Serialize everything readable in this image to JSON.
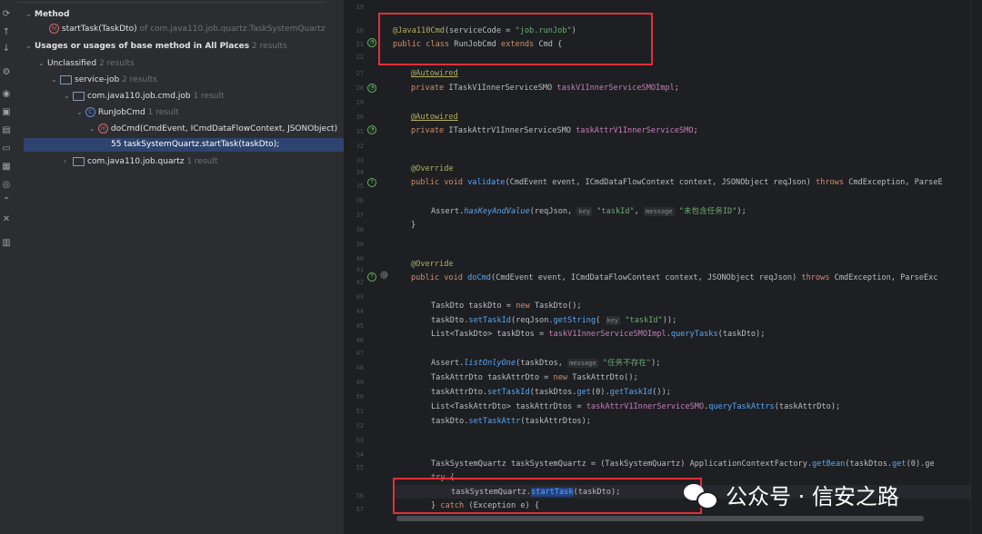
{
  "tree": {
    "method_header": "Method",
    "method_name": "startTask(TaskDto)",
    "method_of": "of com.java110.job.quartz.TaskSystemQuartz",
    "usages_header": "Usages or usages of base method in All Places",
    "usages_count": "2 results",
    "unclassified": "Unclassified",
    "unclassified_count": "2 results",
    "service_job": "service-job",
    "service_job_count": "2 results",
    "pkg_cmd": "com.java110.job.cmd.job",
    "pkg_cmd_count": "1 result",
    "class_name": "RunJobCmd",
    "class_count": "1 result",
    "docmd_sig": "doCmd(CmdEvent, ICmdDataFlowContext, JSONObject)",
    "usage_line": "55 taskSystemQuartz.startTask(taskDto);",
    "pkg_quartz": "com.java110.job.quartz",
    "pkg_quartz_count": "1 result"
  },
  "lines": [
    "19",
    "20",
    "21",
    "22",
    "27",
    "28",
    "29",
    "30",
    "31",
    "32",
    "33",
    "34",
    "35",
    "36",
    "37",
    "38",
    "39",
    "40",
    "41",
    "42",
    "43",
    "44",
    "45",
    "46",
    "47",
    "48",
    "49",
    "50",
    "51",
    "52",
    "53",
    "54",
    "55",
    "56",
    "57"
  ],
  "code": {
    "l1_ann": "@Java110Cmd",
    "l1_open": "(serviceCode = ",
    "l1_str": "\"job.runJob\"",
    "l1_close": ")",
    "l2_kw": "public class ",
    "l2_name": "RunJobCmd ",
    "l2_kw2": "extends ",
    "l2_rest": "Cmd {",
    "aw1": "@Autowired",
    "f1_kw": "private ",
    "f1_type": "ITaskV1InnerServiceSMO ",
    "f1_name": "taskV1InnerServiceSMOImpl",
    "f1_end": ";",
    "aw2": "@Autowired",
    "f2_kw": "private ",
    "f2_type": "ITaskAttrV1InnerServiceSMO ",
    "f2_name": "taskAttrV1InnerServiceSMO",
    "f2_end": ";",
    "ov1": "@Override",
    "v_kw": "public void ",
    "v_name": "validate",
    "v_rest": "(CmdEvent event, ICmdDataFlowContext context, JSONObject reqJson) ",
    "v_kw2": "throws ",
    "v_exc": "CmdException, ParseE",
    "assert1_a": "Assert.",
    "assert1_m": "hasKeyAndValue",
    "assert1_b": "(reqJson, ",
    "hint_key": "key",
    "assert1_s1": "\"taskId\"",
    "assert1_c": ", ",
    "hint_msg": "message",
    "assert1_s2": "\"未包含任务ID\"",
    "assert1_end": ");",
    "brace": "}",
    "ov2": "@Override",
    "d_kw": "public void ",
    "d_name": "doCmd",
    "d_rest": "(CmdEvent event, ICmdDataFlowContext context, JSONObject reqJson) ",
    "d_kw2": "throws ",
    "d_exc": "CmdException, ParseExc",
    "t1_a": "TaskDto taskDto = ",
    "t1_kw": "new ",
    "t1_b": "TaskDto();",
    "t2_a": "taskDto.",
    "t2_m": "setTaskId",
    "t2_b": "(reqJson.",
    "t2_m2": "getString",
    "t2_c": "( ",
    "t2_s": "\"taskId\"",
    "t2_d": "));",
    "t3_a": "List<TaskDto> taskDtos = ",
    "t3_f": "taskV1InnerServiceSMOImpl",
    "t3_b": ".",
    "t3_m": "queryTasks",
    "t3_c": "(taskDto);",
    "t4_a": "Assert.",
    "t4_m": "listOnlyOne",
    "t4_b": "(taskDtos, ",
    "t4_s": "\"任务不存在\"",
    "t4_c": ");",
    "t5_a": "TaskAttrDto taskAttrDto = ",
    "t5_kw": "new ",
    "t5_b": "TaskAttrDto();",
    "t6_a": "taskAttrDto.",
    "t6_m": "setTaskId",
    "t6_b": "(taskDtos.",
    "t6_m2": "get",
    "t6_c": "(0).",
    "t6_m3": "getTaskId",
    "t6_d": "());",
    "t7_a": "List<TaskAttrDto> taskAttrDtos = ",
    "t7_f": "taskAttrV1InnerServiceSMO",
    "t7_b": ".",
    "t7_m": "queryTaskAttrs",
    "t7_c": "(taskAttrDto);",
    "t8_a": "taskDto.",
    "t8_m": "setTaskAttr",
    "t8_b": "(taskAttrDtos);",
    "t9_a": "TaskSystemQuartz taskSystemQuartz = (TaskSystemQuartz) ApplicationContextFactory.",
    "t9_m": "getBean",
    "t9_b": "(taskDtos.",
    "t9_m2": "get",
    "t9_c": "(0).ge",
    "try_kw": "try {",
    "call_a": "taskSystemQuartz.",
    "call_m": "startTask",
    "call_b": "(taskDto);",
    "catch_a": "} ",
    "catch_kw": "catch ",
    "catch_b": "(Exception e) {"
  },
  "watermark": {
    "text": "公众号 · 信安之路"
  },
  "colors": {
    "background": "#1e1f22",
    "panel": "#2b2d30",
    "selection": "#2e436e",
    "highlight_box": "#e0303a"
  }
}
